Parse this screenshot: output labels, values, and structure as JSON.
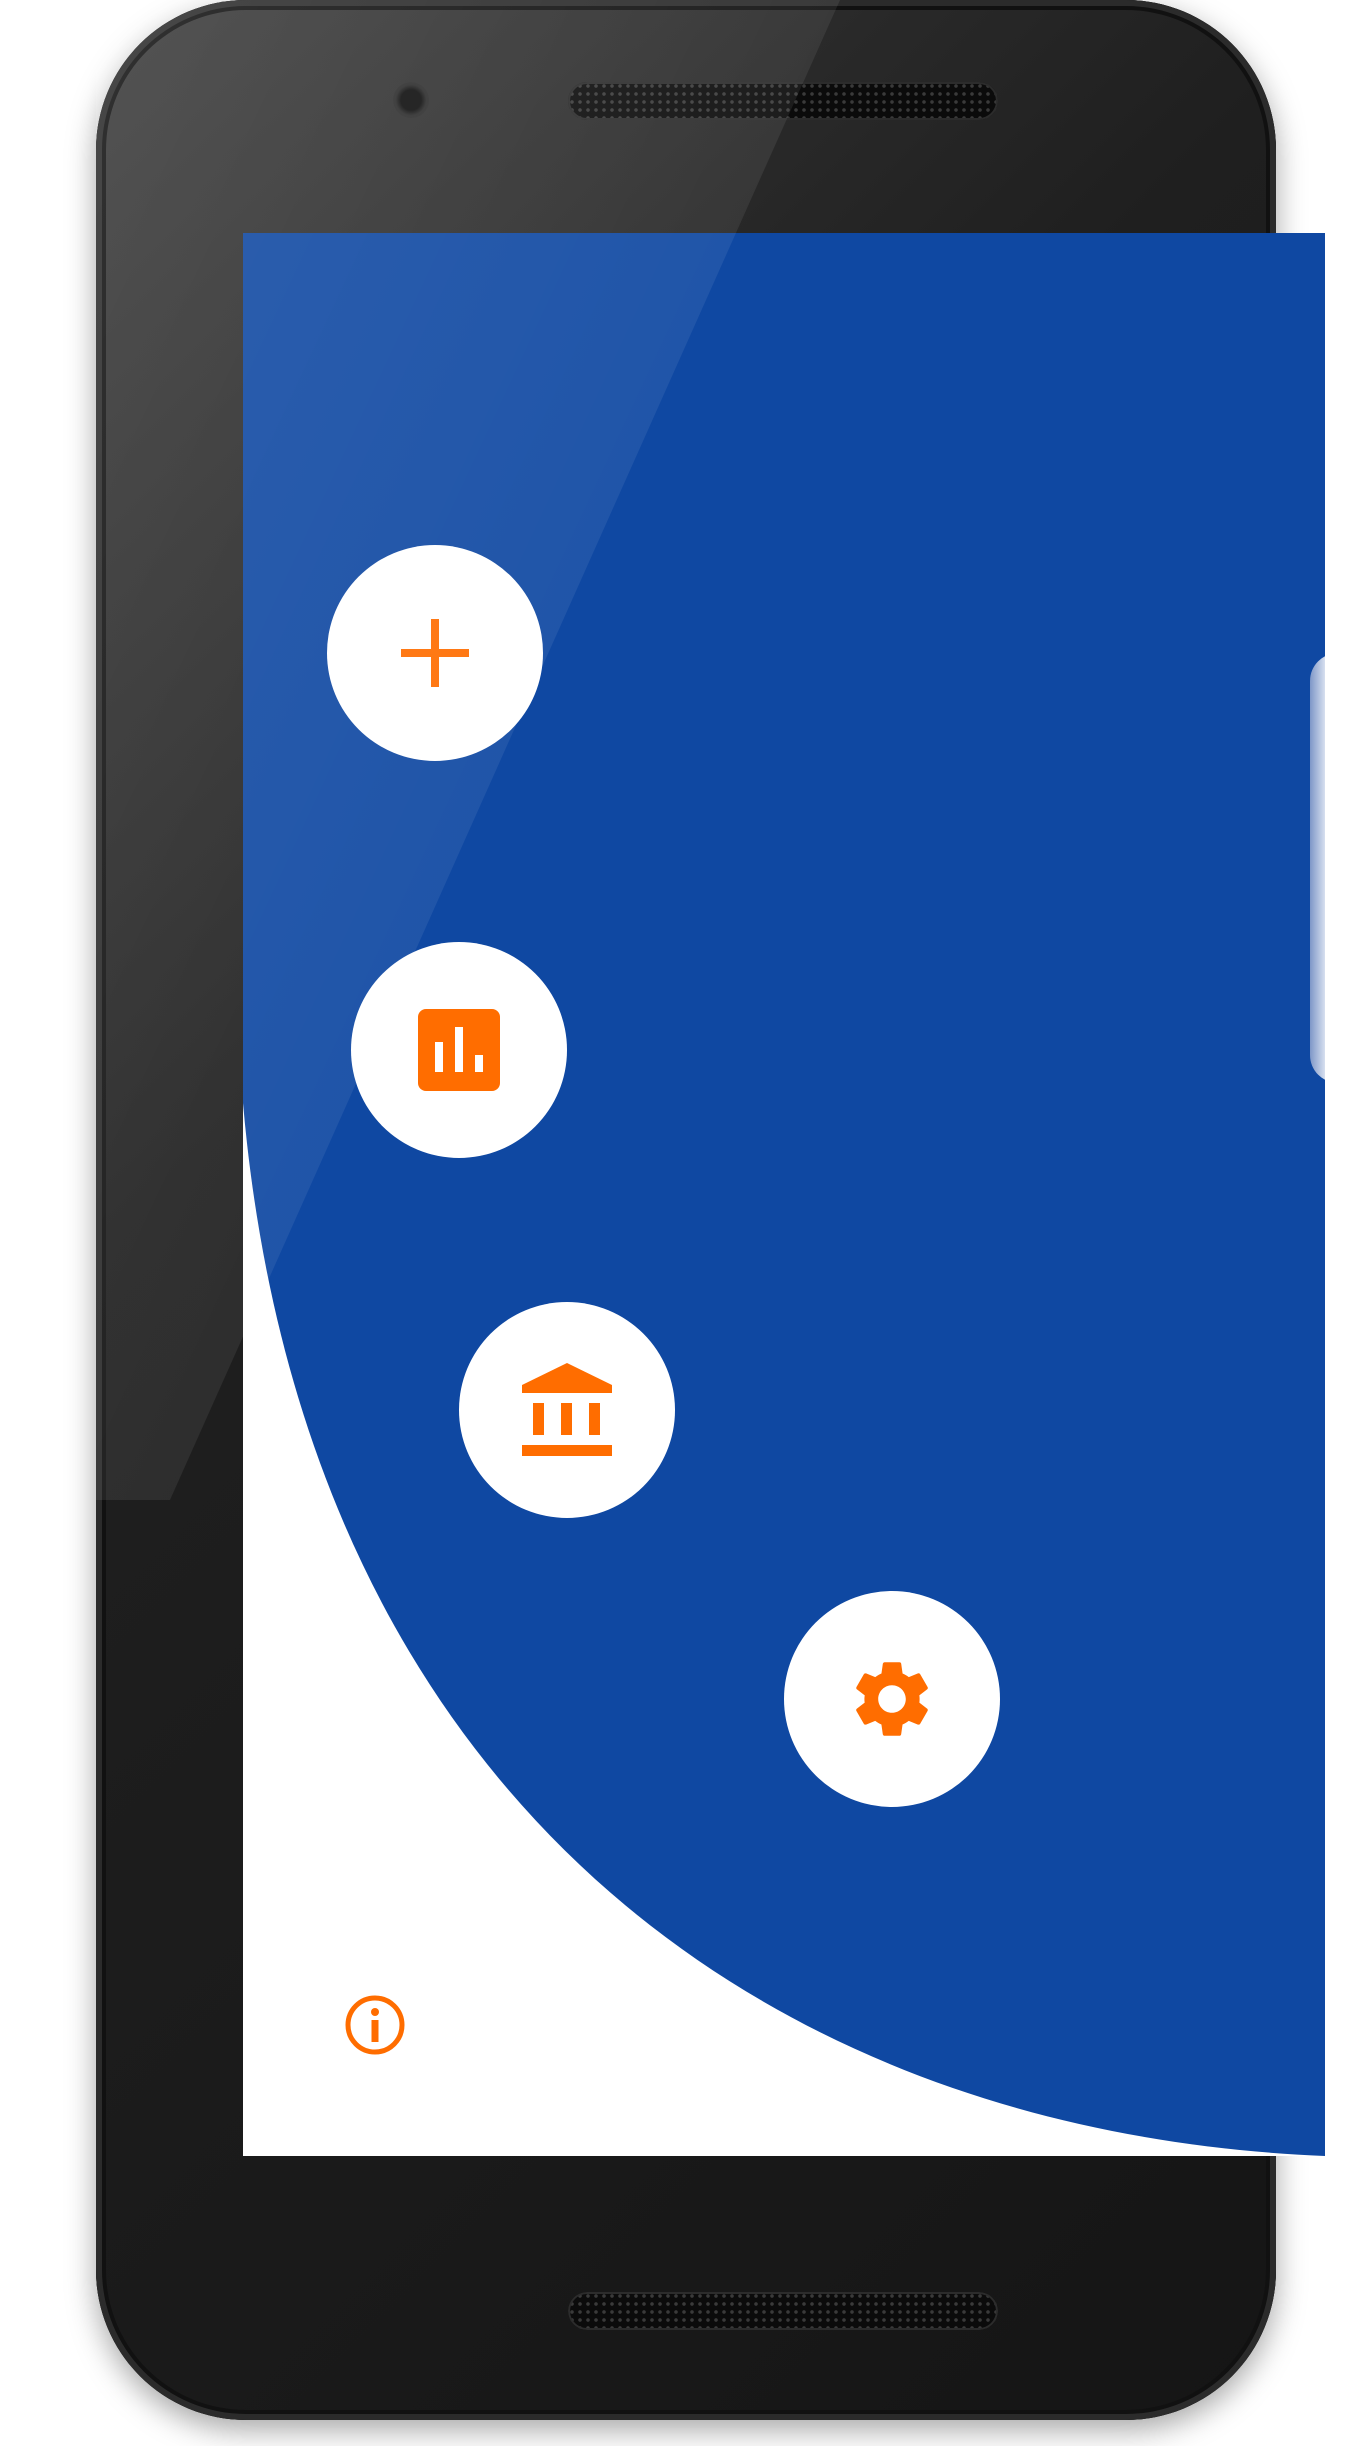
{
  "colors": {
    "primary_blue": "#0f48a2",
    "accent_orange": "#ff6d00",
    "surface_white": "#ffffff",
    "device_body": "#1b1b1b"
  },
  "icons": {
    "add": "plus-icon",
    "stats": "bar-chart-icon",
    "bank": "bank-icon",
    "settings": "gear-icon",
    "info": "info-icon"
  }
}
